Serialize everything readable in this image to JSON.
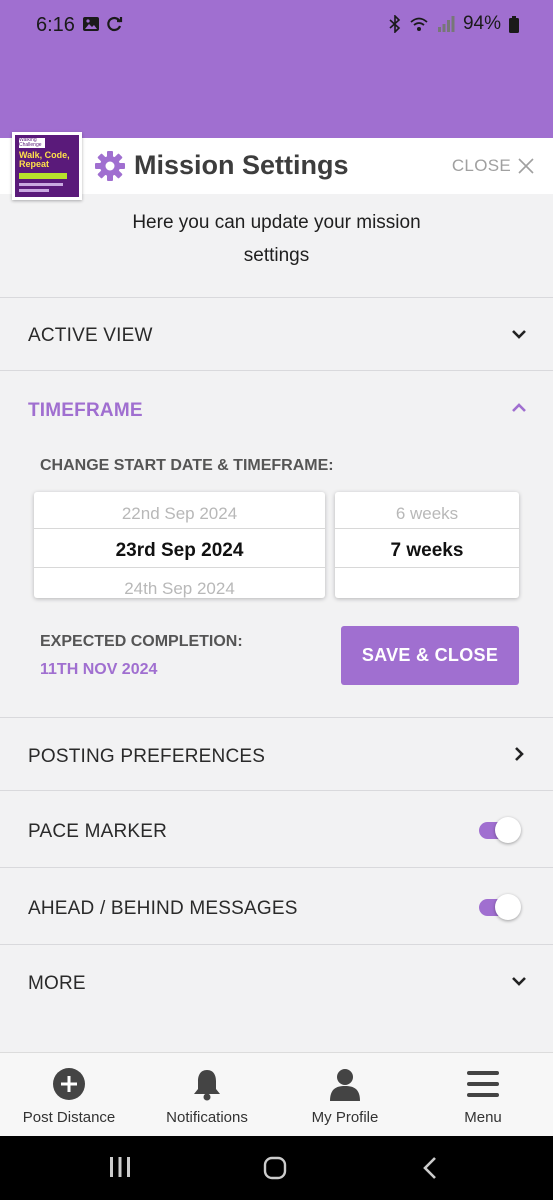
{
  "status_bar": {
    "time": "6:16",
    "battery": "94%"
  },
  "header": {
    "thumbnail": {
      "small_text": "Walking Challenge",
      "title": "Walk, Code, Repeat"
    },
    "title": "Mission Settings",
    "close_label": "CLOSE",
    "intro_line1": "Here you can update your mission",
    "intro_line2": "settings"
  },
  "sections": {
    "active_view": {
      "label": "ACTIVE VIEW",
      "expanded": false
    },
    "timeframe": {
      "label": "TIMEFRAME",
      "expanded": true,
      "sub_label": "CHANGE START DATE & TIMEFRAME:",
      "date_picker": {
        "prev": "22nd Sep 2024",
        "selected": "23rd Sep 2024",
        "next": "24th Sep 2024"
      },
      "weeks_picker": {
        "prev": "6 weeks",
        "selected": "7 weeks",
        "next": ""
      },
      "expected_label": "EXPECTED COMPLETION:",
      "expected_date": "11TH NOV 2024",
      "save_label": "SAVE & CLOSE"
    },
    "posting_preferences": {
      "label": "POSTING PREFERENCES"
    },
    "pace_marker": {
      "label": "PACE MARKER",
      "enabled": true
    },
    "ahead_behind": {
      "label": "AHEAD / BEHIND MESSAGES",
      "enabled": true
    },
    "more": {
      "label": "MORE",
      "expanded": false
    }
  },
  "bottom_nav": [
    {
      "label": "Post Distance",
      "icon": "plus-circle-icon"
    },
    {
      "label": "Notifications",
      "icon": "bell-icon"
    },
    {
      "label": "My Profile",
      "icon": "user-icon"
    },
    {
      "label": "Menu",
      "icon": "hamburger-icon"
    }
  ],
  "colors": {
    "accent": "#a06fd0",
    "background": "#f2f2f3"
  }
}
